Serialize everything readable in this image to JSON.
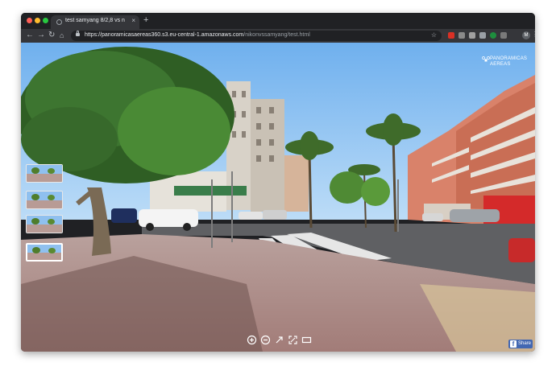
{
  "browser": {
    "tab_title": "test samyang 8/2,8 vs nikon 10.5",
    "tab_close": "×",
    "new_tab": "+",
    "url_host": "https://panoramicasaereas360.s3.eu-central-1.amazonaws.com",
    "url_path": "/nikonvssamyang/test.html",
    "back_icon": "arrow-left",
    "forward_icon": "arrow-right",
    "reload_icon": "reload",
    "home_icon": "home",
    "star_icon": "star",
    "extensions": [
      "extension-red",
      "extension-gray-1",
      "extension-gray-2",
      "extension-gray-3",
      "extension-green",
      "extension-gray-4"
    ],
    "avatar_letter": "M"
  },
  "viewer": {
    "brand_name": "PANORAMICAS AEREAS",
    "thumbnails": [
      {
        "id": "scene-1",
        "active": false
      },
      {
        "id": "scene-2",
        "active": false
      },
      {
        "id": "scene-3",
        "active": false
      },
      {
        "id": "scene-4",
        "active": true
      }
    ],
    "controls": [
      "zoom-in-icon",
      "zoom-out-icon",
      "autorotate-icon",
      "fullscreen-icon",
      "vr-icon"
    ],
    "share_label": "Share",
    "share_icon": "f"
  },
  "colors": {
    "sky": "#8ec3f2",
    "pavement": "#b0908d",
    "facebook": "#4267b2",
    "chrome_dark": "#202124"
  }
}
